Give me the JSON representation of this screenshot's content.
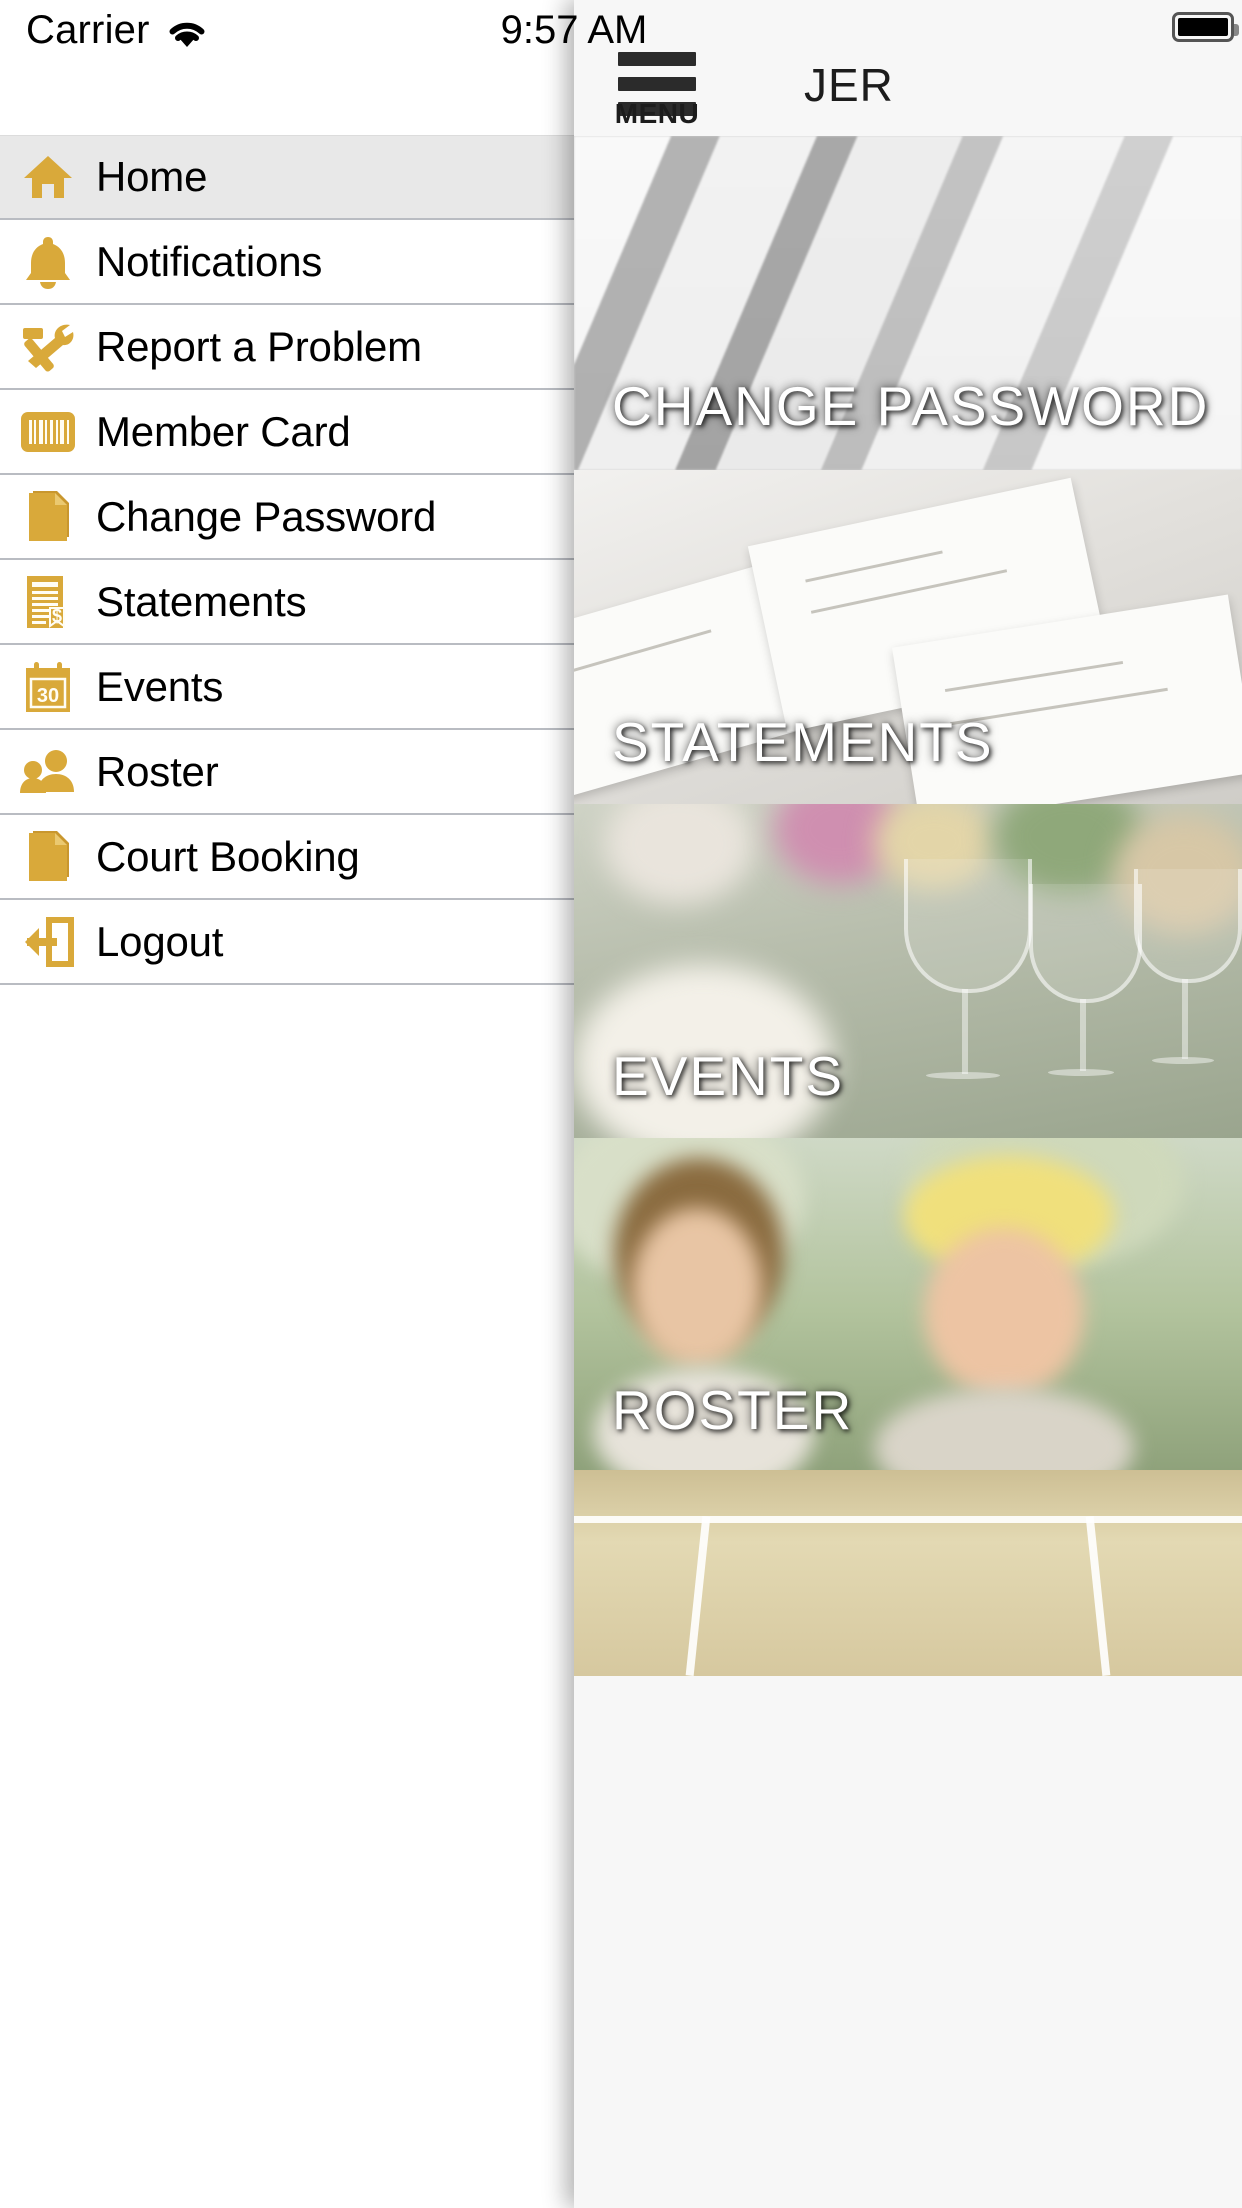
{
  "status_bar": {
    "carrier": "Carrier",
    "wifi_icon": "wifi-icon",
    "time": "9:57 AM",
    "battery_icon": "battery-full-icon"
  },
  "sidebar": {
    "items": [
      {
        "label": "Home",
        "icon": "home-icon",
        "active": true
      },
      {
        "label": "Notifications",
        "icon": "bell-icon",
        "active": false
      },
      {
        "label": "Report a Problem",
        "icon": "tools-icon",
        "active": false
      },
      {
        "label": "Member Card",
        "icon": "barcode-icon",
        "active": false
      },
      {
        "label": "Change Password",
        "icon": "document-icon",
        "active": false
      },
      {
        "label": "Statements",
        "icon": "invoice-dollar-icon",
        "active": false
      },
      {
        "label": "Events",
        "icon": "calendar-30-icon",
        "active": false
      },
      {
        "label": "Roster",
        "icon": "people-icon",
        "active": false
      },
      {
        "label": "Court Booking",
        "icon": "document-icon",
        "active": false
      },
      {
        "label": "Logout",
        "icon": "logout-icon",
        "active": false
      }
    ]
  },
  "panel": {
    "menu_button": {
      "icon": "hamburger-icon",
      "label": "MENU"
    },
    "title": "JER",
    "cards": [
      {
        "label": "CHANGE PASSWORD",
        "art": "blinds-photo"
      },
      {
        "label": "STATEMENTS",
        "art": "documents-photo"
      },
      {
        "label": "EVENTS",
        "art": "table-setting-photo"
      },
      {
        "label": "ROSTER",
        "art": "people-photo"
      },
      {
        "label": "",
        "art": "tennis-court-photo"
      }
    ]
  },
  "colors": {
    "icon_gold": "#D9A93A",
    "active_row": "#E8E8E8",
    "divider": "#B9BCC2",
    "panel_bg": "#F7F7F7",
    "text": "#000000"
  }
}
